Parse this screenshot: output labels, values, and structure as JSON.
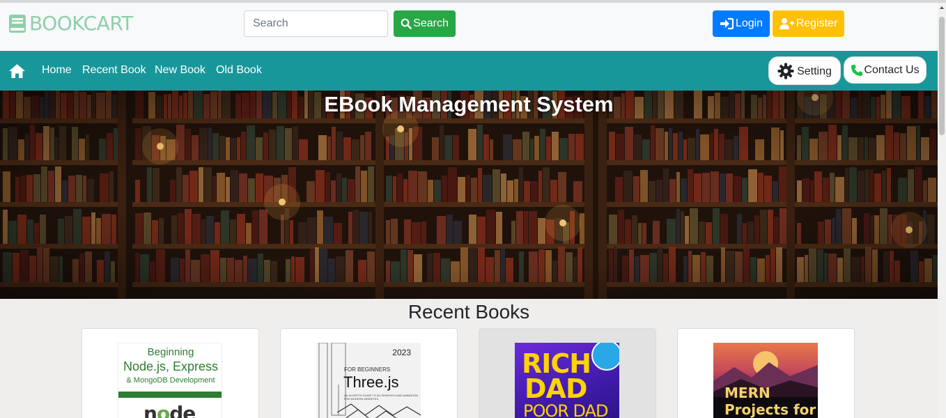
{
  "brand": {
    "name": "BOOKCART",
    "color": "#8ecfa9"
  },
  "search": {
    "placeholder": "Search",
    "button_label": "Search"
  },
  "auth": {
    "login_label": "Login",
    "register_label": "Register"
  },
  "nav": {
    "links": [
      "Home",
      "Recent Book",
      "New Book",
      "Old Book"
    ],
    "setting_label": "Setting",
    "contact_label": "Contact Us",
    "bg_color": "#18979a"
  },
  "hero": {
    "title": "EBook Management System"
  },
  "recent": {
    "title": "Recent Books",
    "books": [
      {
        "cover_lines": [
          "Beginning",
          "Node.js, Express",
          "& MongoDB Development"
        ],
        "cover_logo": "node"
      },
      {
        "year": "2023",
        "subtitle": "FOR BEGINNERS",
        "title": "Three.js",
        "tagline": "AN IN-DEPTH GUIDE TO 3D GRAPHICS AND ANIMATION FOR MODERN WEBSITES"
      },
      {
        "title_lines": [
          "RICH",
          "DAD",
          "POOR DAD"
        ]
      },
      {
        "title_lines": [
          "MERN",
          "Projects for"
        ]
      }
    ]
  },
  "colors": {
    "success": "#28a745",
    "primary": "#007bff",
    "warning": "#ffc107"
  }
}
